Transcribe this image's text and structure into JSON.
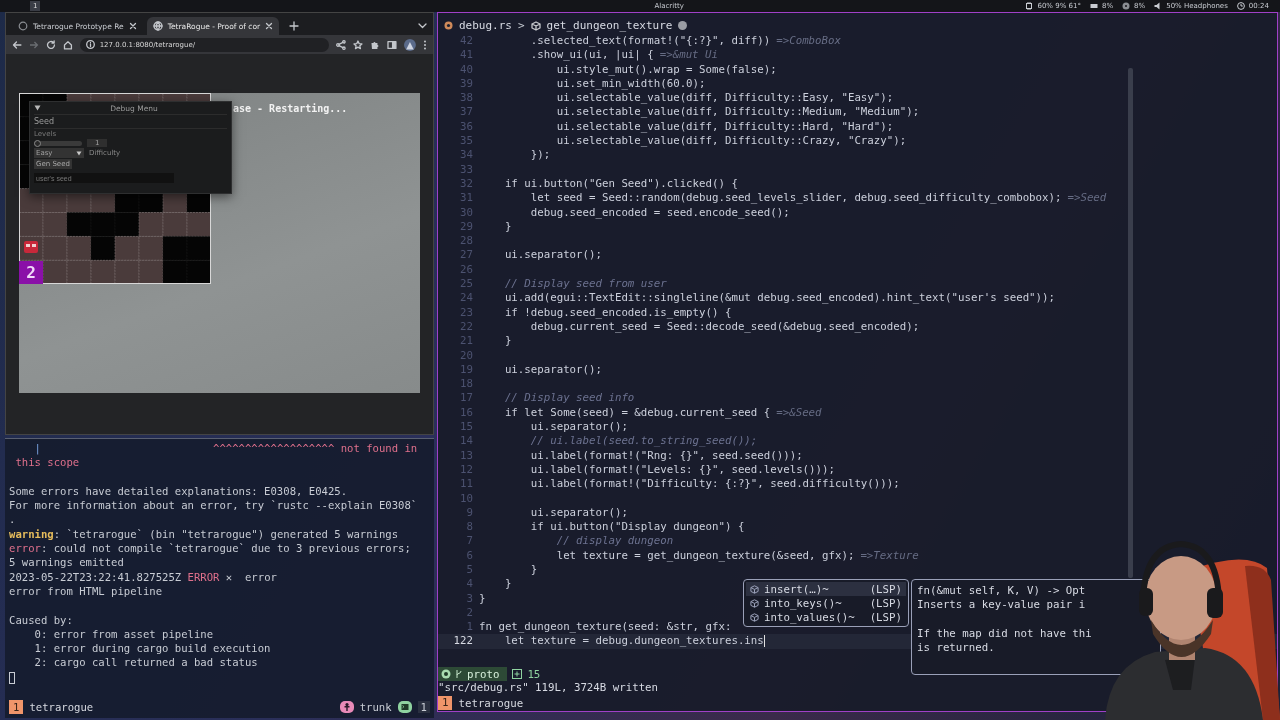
{
  "top_bar": {
    "workspace": "1",
    "title": "Alacritty",
    "status": [
      {
        "text": "60% 9% 61°",
        "kind": "cpu"
      },
      {
        "text": "8%",
        "kind": "memory"
      },
      {
        "text": "8%",
        "kind": "disk"
      },
      {
        "text": "50% Headphones",
        "kind": "volume"
      },
      {
        "text": "00:24",
        "kind": "clock"
      }
    ]
  },
  "browser": {
    "tabs": [
      {
        "title": "Tetrarogue Prototype Re",
        "selected": false
      },
      {
        "title": "TetraRogue - Proof of cor",
        "selected": true
      }
    ],
    "address": "127.0.0.1:8080/tetrarogue/",
    "game": {
      "banner": "ase - Restarting...",
      "level_badge": "2",
      "debug_menu": {
        "title": "Debug Menu",
        "section": "Seed",
        "levels_label": "Levels",
        "levels_slider": {
          "level": 0,
          "value": "1"
        },
        "difficulty": {
          "value": "Easy",
          "label": "Difficulty"
        },
        "gen_button": "Gen Seed",
        "seed_field": {
          "placeholder": "user's seed"
        }
      }
    }
  },
  "terminal": {
    "lines": [
      {
        "segments": [
          {
            "text": "    |",
            "kind": "gutter"
          },
          {
            "text": "                           ^^^^^^^^^^^^^^^^^^^ not found in",
            "kind": "error"
          }
        ]
      },
      {
        "segments": [
          {
            "text": " this scope",
            "kind": "error"
          }
        ]
      },
      {
        "gap_before": true,
        "segments": [
          {
            "text": "Some errors have detailed explanations: E0308, E0425.",
            "kind": "plain"
          }
        ]
      },
      {
        "segments": [
          {
            "text": "For more information about an error, try `rustc --explain E0308`",
            "kind": "plain"
          }
        ]
      },
      {
        "segments": [
          {
            "text": ".",
            "kind": "plain"
          }
        ]
      },
      {
        "segments": [
          {
            "text": "warning",
            "kind": "warning"
          },
          {
            "text": ": `tetrarogue` (bin \"tetrarogue\") generated 5 warnings",
            "kind": "plain"
          }
        ]
      },
      {
        "segments": [
          {
            "text": "error",
            "kind": "error"
          },
          {
            "text": ": could not compile `tetrarogue` due to 3 previous errors;",
            "kind": "plain"
          }
        ]
      },
      {
        "segments": [
          {
            "text": "5 warnings emitted",
            "kind": "plain"
          }
        ]
      },
      {
        "segments": [
          {
            "text": "2023-05-22T23:22:41.827525Z ",
            "kind": "plain"
          },
          {
            "text": "ERROR",
            "kind": "error"
          },
          {
            "text": " ✕  error",
            "kind": "plain"
          }
        ]
      },
      {
        "segments": [
          {
            "text": "error from HTML pipeline",
            "kind": "plain"
          }
        ]
      },
      {
        "gap_before": true,
        "segments": [
          {
            "text": "Caused by:",
            "kind": "plain"
          }
        ]
      },
      {
        "segments": [
          {
            "text": "    0: error from asset pipeline",
            "kind": "plain"
          }
        ]
      },
      {
        "segments": [
          {
            "text": "    1: error during cargo build execution",
            "kind": "plain"
          }
        ]
      },
      {
        "segments": [
          {
            "text": "    2: cargo call returned a bad status",
            "kind": "plain"
          }
        ]
      }
    ],
    "status_bar": {
      "window_index": "1",
      "window_name": "tetrarogue",
      "branch": "trunk",
      "panes": "1"
    }
  },
  "editor": {
    "breadcrumb": {
      "file": "debug.rs",
      "separator": ">",
      "symbol": "get_dungeon_texture",
      "modified": true
    },
    "lines": [
      {
        "number": "42",
        "kind": "code",
        "code": "        .selected_text(format!(\"{:?}\", diff))",
        "hint": "=>ComboBox",
        "current": false
      },
      {
        "number": "41",
        "kind": "code",
        "code": "        .show_ui(ui, |ui| {",
        "hint": "=>&mut Ui",
        "current": false
      },
      {
        "number": "40",
        "kind": "code",
        "code": "            ui.style_mut().wrap = Some(false);",
        "current": false
      },
      {
        "number": "39",
        "kind": "code",
        "code": "            ui.set_min_width(60.0);",
        "current": false
      },
      {
        "number": "38",
        "kind": "code",
        "code": "            ui.selectable_value(diff, Difficulty::Easy, \"Easy\");",
        "current": false
      },
      {
        "number": "37",
        "kind": "code",
        "code": "            ui.selectable_value(diff, Difficulty::Medium, \"Medium\");",
        "current": false
      },
      {
        "number": "36",
        "kind": "code",
        "code": "            ui.selectable_value(diff, Difficulty::Hard, \"Hard\");",
        "current": false
      },
      {
        "number": "35",
        "kind": "code",
        "code": "            ui.selectable_value(diff, Difficulty::Crazy, \"Crazy\");",
        "current": false
      },
      {
        "number": "34",
        "kind": "code",
        "code": "        });",
        "current": false
      },
      {
        "number": "33",
        "kind": "empty",
        "current": false
      },
      {
        "number": "32",
        "kind": "code",
        "code": "    if ui.button(\"Gen Seed\").clicked() {",
        "current": false
      },
      {
        "number": "31",
        "kind": "code",
        "code": "        let seed = Seed::random(debug.seed_levels_slider, debug.seed_difficulty_combobox);",
        "hint": "=>Seed",
        "current": false
      },
      {
        "number": "30",
        "kind": "code",
        "code": "        debug.seed_encoded = seed.encode_seed();",
        "current": false
      },
      {
        "number": "29",
        "kind": "code",
        "code": "    }",
        "current": false
      },
      {
        "number": "28",
        "kind": "empty",
        "current": false
      },
      {
        "number": "27",
        "kind": "code",
        "code": "    ui.separator();",
        "current": false
      },
      {
        "number": "26",
        "kind": "empty",
        "current": false
      },
      {
        "number": "25",
        "kind": "comment",
        "code": "    // Display seed from user",
        "current": false
      },
      {
        "number": "24",
        "kind": "code",
        "code": "    ui.add(egui::TextEdit::singleline(&mut debug.seed_encoded).hint_text(\"user's seed\"));",
        "current": false
      },
      {
        "number": "23",
        "kind": "code",
        "code": "    if !debug.seed_encoded.is_empty() {",
        "current": false
      },
      {
        "number": "22",
        "kind": "code",
        "code": "        debug.current_seed = Seed::decode_seed(&debug.seed_encoded);",
        "current": false
      },
      {
        "number": "21",
        "kind": "code",
        "code": "    }",
        "current": false
      },
      {
        "number": "20",
        "kind": "empty",
        "current": false
      },
      {
        "number": "19",
        "kind": "code",
        "code": "    ui.separator();",
        "current": false
      },
      {
        "number": "18",
        "kind": "empty",
        "current": false
      },
      {
        "number": "17",
        "kind": "comment",
        "code": "    // Display seed info",
        "current": false
      },
      {
        "number": "16",
        "kind": "code",
        "code": "    if let Some(seed) = &debug.current_seed {",
        "hint": "=>&Seed",
        "current": false
      },
      {
        "number": "15",
        "kind": "code",
        "code": "        ui.separator();",
        "current": false
      },
      {
        "number": "14",
        "kind": "comment",
        "code": "        // ui.label(seed.to_string_seed());",
        "current": false
      },
      {
        "number": "13",
        "kind": "code",
        "code": "        ui.label(format!(\"Rng: {}\", seed.seed()));",
        "current": false
      },
      {
        "number": "12",
        "kind": "code",
        "code": "        ui.label(format!(\"Levels: {}\", seed.levels()));",
        "current": false
      },
      {
        "number": "11",
        "kind": "code",
        "code": "        ui.label(format!(\"Difficulty: {:?}\", seed.difficulty()));",
        "current": false
      },
      {
        "number": "10",
        "kind": "empty",
        "current": false
      },
      {
        "number": "9",
        "kind": "code",
        "code": "        ui.separator();",
        "current": false
      },
      {
        "number": "8",
        "kind": "code",
        "code": "        if ui.button(\"Display dungeon\") {",
        "current": false
      },
      {
        "number": "7",
        "kind": "comment",
        "code": "            // display dungeon",
        "current": false
      },
      {
        "number": "6",
        "kind": "code",
        "code": "            let texture = get_dungeon_texture(&seed, gfx);",
        "hint": "=>Texture",
        "current": false
      },
      {
        "number": "5",
        "kind": "code",
        "code": "        }",
        "current": false
      },
      {
        "number": "4",
        "kind": "code",
        "code": "    }",
        "current": false
      },
      {
        "number": "3",
        "kind": "code",
        "code": "}",
        "current": false
      },
      {
        "number": "2",
        "kind": "empty",
        "current": false
      },
      {
        "number": "1",
        "kind": "code",
        "code": "fn get_dungeon_texture(seed: &str, gfx:",
        "current": false
      },
      {
        "number": "122",
        "kind": "code",
        "code": "    let texture = debug.dungeon_textures.ins",
        "current": true
      }
    ],
    "completion": [
      {
        "label": "insert(…)~",
        "source": "(LSP)",
        "selected": true
      },
      {
        "label": "into_keys()~",
        "source": "(LSP)",
        "selected": false
      },
      {
        "label": "into_values()~",
        "source": "(LSP)",
        "selected": false
      }
    ],
    "doc": [
      {
        "text": "fn(&mut self, K, V) -> Opt",
        "gap_before": false
      },
      {
        "text": "Inserts a key-value pair i",
        "gap_before": false
      },
      {
        "text": "If the map did not have thi",
        "gap_before": true
      },
      {
        "text": "is returned.",
        "gap_before": false
      }
    ],
    "status": {
      "branch": "proto",
      "added": "15"
    },
    "message": "\"src/debug.rs\" 119L, 3724B written",
    "tmux": {
      "window_index": "1",
      "window_name": "tetrarogue"
    }
  }
}
